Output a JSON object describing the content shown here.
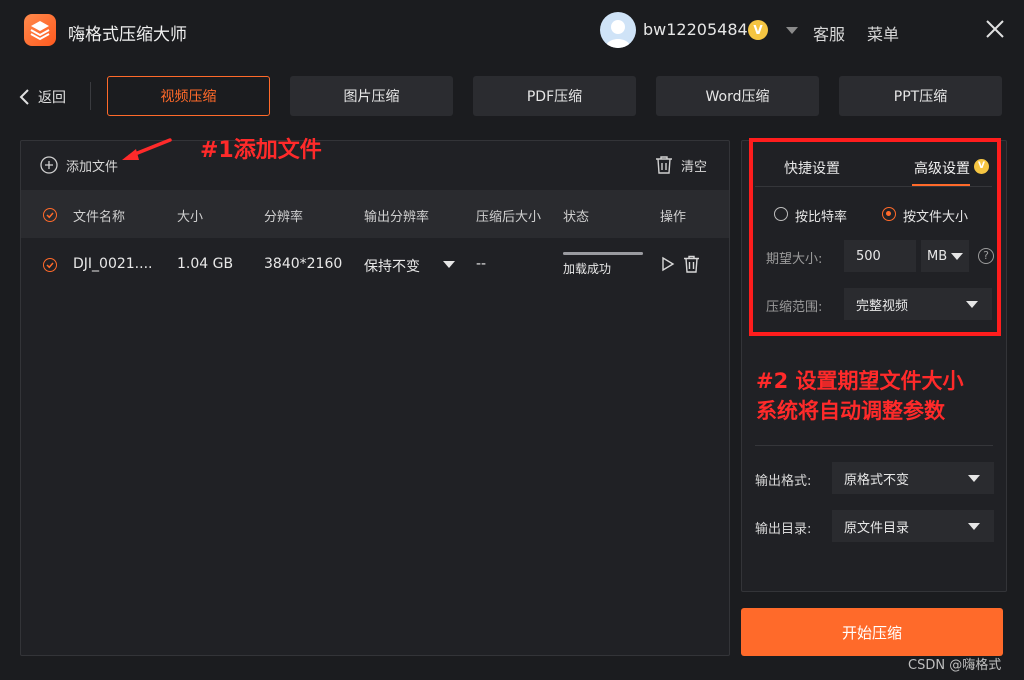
{
  "app": {
    "title": "嗨格式压缩大师"
  },
  "user": {
    "name": "bw12205484",
    "vip_badge": "V"
  },
  "titlebar": {
    "service": "客服",
    "menu": "菜单"
  },
  "nav": {
    "back": "返回",
    "tabs": [
      {
        "label": "视频压缩",
        "active": true
      },
      {
        "label": "图片压缩"
      },
      {
        "label": "PDF压缩"
      },
      {
        "label": "Word压缩"
      },
      {
        "label": "PPT压缩"
      }
    ]
  },
  "file_panel": {
    "add_file": "添加文件",
    "clear": "清空",
    "columns": [
      "文件名称",
      "大小",
      "分辨率",
      "输出分辨率",
      "压缩后大小",
      "状态",
      "操作"
    ],
    "rows": [
      {
        "name": "DJI_0021....",
        "size": "1.04 GB",
        "resolution": "3840*2160",
        "output_resolution": "保持不变",
        "compressed_size": "--",
        "status": "加载成功",
        "progress": 1.0
      }
    ]
  },
  "settings": {
    "tabs": [
      "快捷设置",
      "高级设置"
    ],
    "advanced_badge": "V",
    "mode_options": [
      "按比特率",
      "按文件大小"
    ],
    "selected_mode": "按文件大小",
    "expected_size_label": "期望大小:",
    "expected_size_value": "500",
    "expected_size_unit": "MB",
    "range_label": "压缩范围:",
    "range_value": "完整视频",
    "output_format_label": "输出格式:",
    "output_format_value": "原格式不变",
    "output_dir_label": "输出目录:",
    "output_dir_value": "原文件目录"
  },
  "annotations": {
    "step1": "#1添加文件",
    "step2_line1": "#2 设置期望文件大小",
    "step2_line2": "系统将自动调整参数"
  },
  "start_button": "开始压缩",
  "watermark": "CSDN @嗨格式",
  "colors": {
    "accent": "#ff6a2a",
    "annotation": "#ff2a2a",
    "background": "#1b1c1f"
  }
}
